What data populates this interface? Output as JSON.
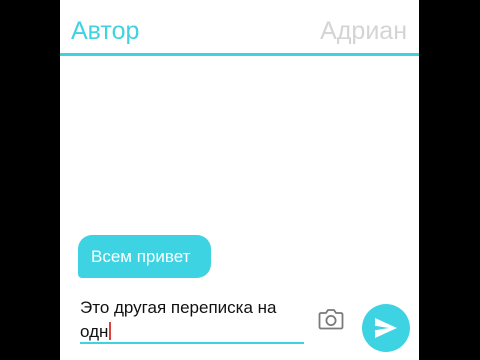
{
  "header": {
    "author_title": "Автор",
    "contact_title": "Адриан"
  },
  "messages": [
    {
      "text": "Всем привет",
      "sender": "left"
    }
  ],
  "composer": {
    "value": "Это другая переписка на одн",
    "camera_icon": "camera-icon",
    "send_icon": "send-icon"
  },
  "colors": {
    "accent": "#3ed3e3",
    "contact_title": "#d4d4d4",
    "caret": "#e0403c",
    "background": "#ffffff"
  }
}
